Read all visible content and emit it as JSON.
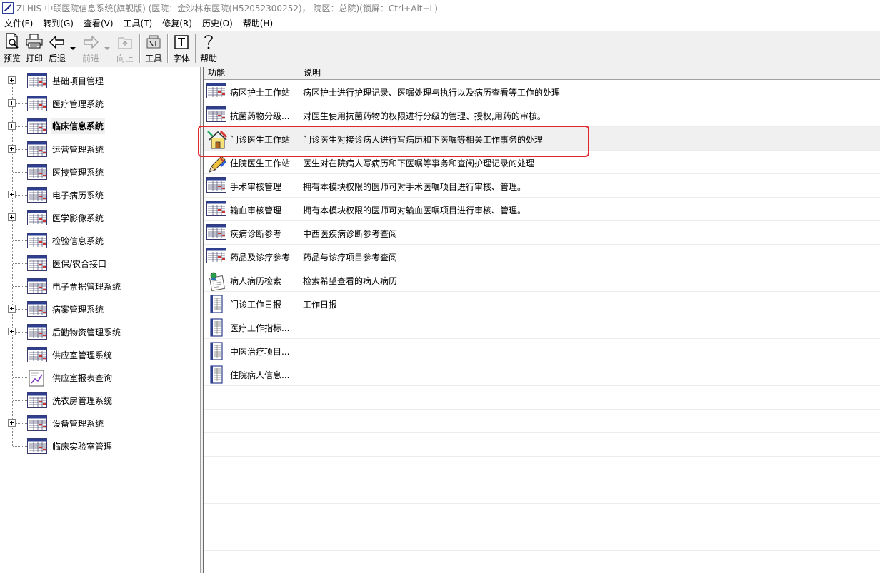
{
  "window": {
    "title": "ZLHIS-中联医院信息系统(旗舰版) (医院：金沙林东医院(H52052300252)，  院区：总院)(锁屏：Ctrl+Alt+L)"
  },
  "menu": [
    "文件(F)",
    "转到(G)",
    "查看(V)",
    "工具(T)",
    "修复(R)",
    "历史(O)",
    "帮助(H)"
  ],
  "toolbar": {
    "preview": "预览",
    "print": "打印",
    "back": "后退",
    "forward": "前进",
    "up": "向上",
    "tools": "工具",
    "font": "字体",
    "help": "帮助"
  },
  "tree": {
    "items": [
      {
        "label": "基础项目管理",
        "expandable": true,
        "icon": "table-window-icon"
      },
      {
        "label": "医疗管理系统",
        "expandable": true,
        "icon": "table-window-icon"
      },
      {
        "label": "临床信息系统",
        "expandable": true,
        "icon": "table-window-icon",
        "selected": true
      },
      {
        "label": "运营管理系统",
        "expandable": true,
        "icon": "table-window-icon"
      },
      {
        "label": "医技管理系统",
        "expandable": false,
        "icon": "table-window-icon"
      },
      {
        "label": "电子病历系统",
        "expandable": true,
        "icon": "table-window-icon"
      },
      {
        "label": "医学影像系统",
        "expandable": true,
        "icon": "table-window-icon"
      },
      {
        "label": "检验信息系统",
        "expandable": false,
        "icon": "table-window-icon"
      },
      {
        "label": "医保/农合接口",
        "expandable": false,
        "icon": "table-window-icon"
      },
      {
        "label": "电子票据管理系统",
        "expandable": false,
        "icon": "table-window-icon"
      },
      {
        "label": "病案管理系统",
        "expandable": true,
        "icon": "table-window-icon"
      },
      {
        "label": "后勤物资管理系统",
        "expandable": true,
        "icon": "table-window-icon"
      },
      {
        "label": "供应室管理系统",
        "expandable": false,
        "icon": "table-window-icon"
      },
      {
        "label": "供应室报表查询",
        "expandable": false,
        "icon": "report-chart-icon"
      },
      {
        "label": "洗衣房管理系统",
        "expandable": false,
        "icon": "table-window-icon"
      },
      {
        "label": "设备管理系统",
        "expandable": true,
        "icon": "table-window-icon"
      },
      {
        "label": "临床实验室管理",
        "expandable": false,
        "icon": "table-window-icon"
      }
    ]
  },
  "list": {
    "headers": {
      "function": "功能",
      "description": "说明"
    },
    "rows": [
      {
        "name": "病区护士工作站",
        "desc": "病区护士进行护理记录、医嘱处理与执行以及病历查看等工作的处理",
        "icon": "table-window-icon"
      },
      {
        "name": "抗菌药物分级...",
        "desc": "对医生使用抗菌药物的权限进行分级的管理、授权,用药的审核。",
        "icon": "table-window-icon"
      },
      {
        "name": "门诊医生工作站",
        "desc": "门诊医生对接诊病人进行写病历和下医嘱等相关工作事务的处理",
        "icon": "house-tools-icon",
        "highlighted": true
      },
      {
        "name": "住院医生工作站",
        "desc": "医生对在院病人写病历和下医嘱等事务和查阅护理记录的处理",
        "icon": "pencil-tools-icon"
      },
      {
        "name": "手术审核管理",
        "desc": "拥有本模块权限的医师可对手术医嘱项目进行审核、管理。",
        "icon": "table-window-icon"
      },
      {
        "name": "输血审核管理",
        "desc": "拥有本模块权限的医师可对输血医嘱项目进行审核、管理。",
        "icon": "table-window-icon"
      },
      {
        "name": "疾病诊断参考",
        "desc": "中西医疾病诊断参考查阅",
        "icon": "table-window-icon"
      },
      {
        "name": "药品及诊疗参考",
        "desc": "药品与诊疗项目参考查阅",
        "icon": "table-window-icon"
      },
      {
        "name": "病人病历检索",
        "desc": "检索希望查看的病人病历",
        "icon": "patient-record-icon"
      },
      {
        "name": "门诊工作日报",
        "desc": "工作日报",
        "icon": "report-sheet-icon"
      },
      {
        "name": "医疗工作指标...",
        "desc": "",
        "icon": "report-sheet-icon"
      },
      {
        "name": "中医治疗项目...",
        "desc": "",
        "icon": "report-sheet-icon"
      },
      {
        "name": "住院病人信息...",
        "desc": "",
        "icon": "report-sheet-icon"
      }
    ]
  },
  "colors": {
    "highlight_box": "#e3262b",
    "row_highlight": "#f0f0f0"
  }
}
